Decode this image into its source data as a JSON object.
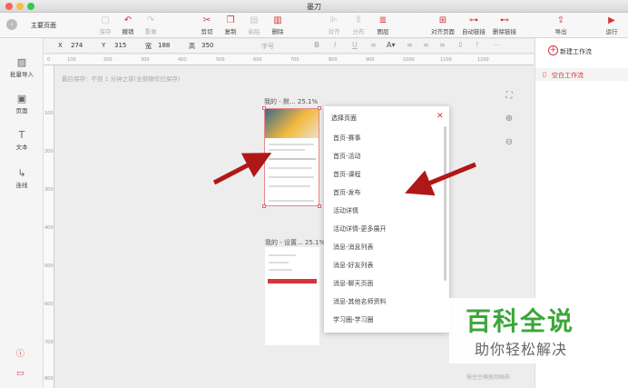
{
  "window": {
    "title": "墨刀"
  },
  "toolbar": {
    "home": "主要页面",
    "buttons": [
      {
        "label": "保存",
        "icon": "save-icon",
        "glyph": "▢",
        "state": "dim"
      },
      {
        "label": "撤销",
        "icon": "undo-icon",
        "glyph": "↶",
        "state": "red"
      },
      {
        "label": "重做",
        "icon": "redo-icon",
        "glyph": "↷",
        "state": "dim"
      },
      {
        "label": "剪切",
        "icon": "scissors-icon",
        "glyph": "✂",
        "state": "red"
      },
      {
        "label": "复制",
        "icon": "copy-icon",
        "glyph": "❐",
        "state": "red"
      },
      {
        "label": "粘贴",
        "icon": "paste-icon",
        "glyph": "▤",
        "state": "dim"
      },
      {
        "label": "删除",
        "icon": "trash-icon",
        "glyph": "▥",
        "state": "red"
      },
      {
        "label": "对齐",
        "icon": "align-icon",
        "glyph": "⊫",
        "state": "dim"
      },
      {
        "label": "分布",
        "icon": "distribute-icon",
        "glyph": "⫴",
        "state": "dim"
      },
      {
        "label": "图层",
        "icon": "layers-icon",
        "glyph": "≣",
        "state": "red"
      },
      {
        "label": "对齐页面",
        "icon": "align-page-icon",
        "glyph": "⊞",
        "state": "red"
      },
      {
        "label": "自动链接",
        "icon": "auto-link-icon",
        "glyph": "⊶",
        "state": "red"
      },
      {
        "label": "删除链接",
        "icon": "delete-link-icon",
        "glyph": "⊷",
        "state": "red"
      },
      {
        "label": "导出",
        "icon": "export-icon",
        "glyph": "⇪",
        "state": "red"
      },
      {
        "label": "运行",
        "icon": "run-icon",
        "glyph": "▶",
        "state": "red"
      }
    ]
  },
  "props": {
    "x_label": "X",
    "x": "274",
    "y_label": "Y",
    "y": "315",
    "w_label": "宽",
    "w": "188",
    "h_label": "高",
    "h": "350",
    "font_label": "字号"
  },
  "left": {
    "items": [
      {
        "label": "批量导入",
        "icon": "batch-import-icon",
        "glyph": "▨"
      },
      {
        "label": "页面",
        "icon": "page-icon",
        "glyph": "▣"
      },
      {
        "label": "文本",
        "icon": "text-icon",
        "glyph": "T"
      },
      {
        "label": "连线",
        "icon": "connector-icon",
        "glyph": "↳"
      }
    ],
    "help_icon": "help-icon",
    "feedback_icon": "feedback-icon"
  },
  "canvas": {
    "save_msg": "最后保存：不到 1 分钟之前(全部操作已保存)",
    "hint": "按住空格拖动画布",
    "page1_title": "我的 - 默... 25.1%",
    "page2_title": "我的 - 设置... 25.1%",
    "ruler_h": [
      "0",
      "100",
      "200",
      "300",
      "400",
      "500",
      "600",
      "700",
      "800",
      "900",
      "1000",
      "1100",
      "1200"
    ],
    "ruler_v": [
      "100",
      "200",
      "300",
      "400",
      "500",
      "600",
      "700",
      "800"
    ]
  },
  "right": {
    "new_flow": "新建工作流",
    "blank_flow": "空白工作流"
  },
  "popup": {
    "title": "选择页面",
    "items": [
      "首页-赛事",
      "首页-活动",
      "首页-课程",
      "首页-发布",
      "活动详情",
      "活动详情-更多展开",
      "消息-消息列表",
      "消息-好友列表",
      "消息-聊天页面",
      "消息-其他名师资料",
      "学习圈-学习圈"
    ]
  },
  "watermark": {
    "title": "百科全说",
    "subtitle": "助你轻松解决"
  },
  "colors": {
    "accent": "#d6353a",
    "watermark": "#3da63a"
  }
}
